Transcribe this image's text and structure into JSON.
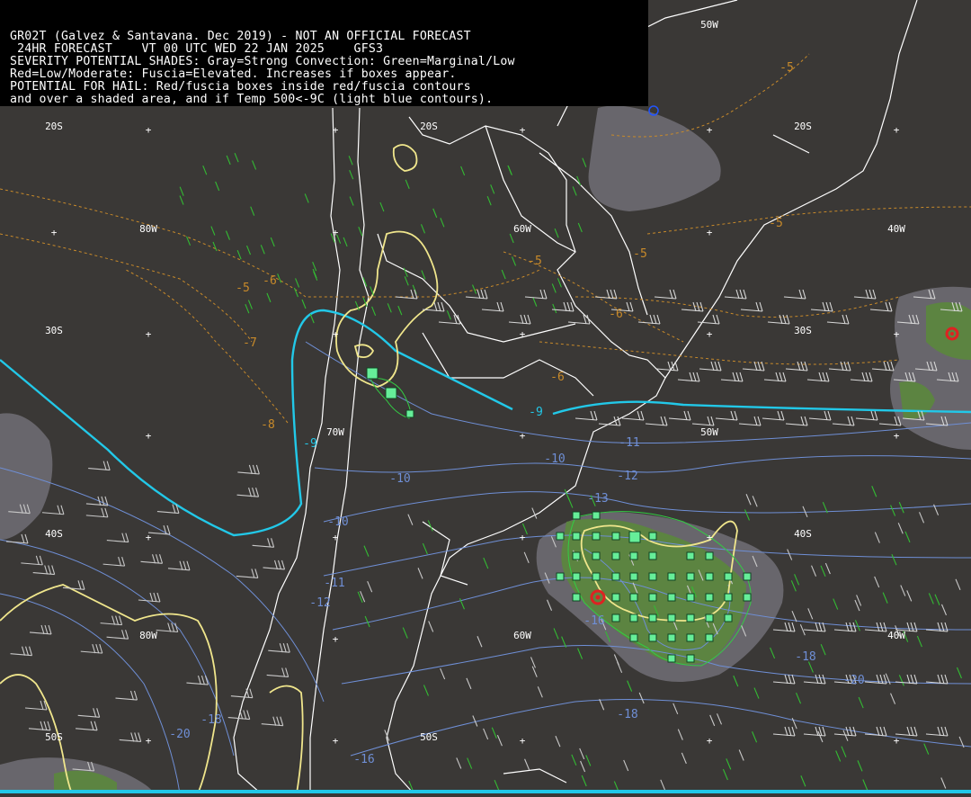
{
  "header": {
    "lines": [
      "GR02T (Galvez & Santavana. Dec 2019) - NOT AN OFFICIAL FORECAST",
      " 24HR FORECAST    VT 00 UTC WED 22 JAN 2025    GFS3",
      "SEVERITY POTENTIAL SHADES: Gray=Strong Convection: Green=Marginal/Low",
      "Red=Low/Moderate: Fuscia=Elevated. Increases if boxes appear.",
      "POTENTIAL FOR HAIL: Red/fuscia boxes inside red/fuscia contours",
      "and over a shaded area, and if Temp 500<-9C (light blue contours)."
    ]
  },
  "grid_labels": [
    "20S",
    "20S",
    "20S",
    "50W",
    "80W",
    "60W",
    "40W",
    "30S",
    "30S",
    "70W",
    "50W",
    "40S",
    "40S",
    "80W",
    "60W",
    "40W",
    "50S",
    "50S"
  ],
  "temp_labels": [
    "-5",
    "-5",
    "-5",
    "-5",
    "-6",
    "-5",
    "-6",
    "-7",
    "-8",
    "-6",
    "-9",
    "-9",
    "-11",
    "-10",
    "-10",
    "-12",
    "-13",
    "-10",
    "-11",
    "-12",
    "-16",
    "-18",
    "-20",
    "-18",
    "-18",
    "-20",
    "-16"
  ],
  "colors": {
    "background": "#3a3836",
    "coastline": "#ffffff",
    "temp_contour": "#6f8fd6",
    "temp_minus9_contour": "#22c8e8",
    "warm_dashed_contour": "#c88a2a",
    "severity_contour": "#f0e68c",
    "gray_shade": "#6e6c72",
    "green_shade": "#5a8a3a",
    "green_box": "#66ee99",
    "hail_marker": "#dd2222"
  }
}
